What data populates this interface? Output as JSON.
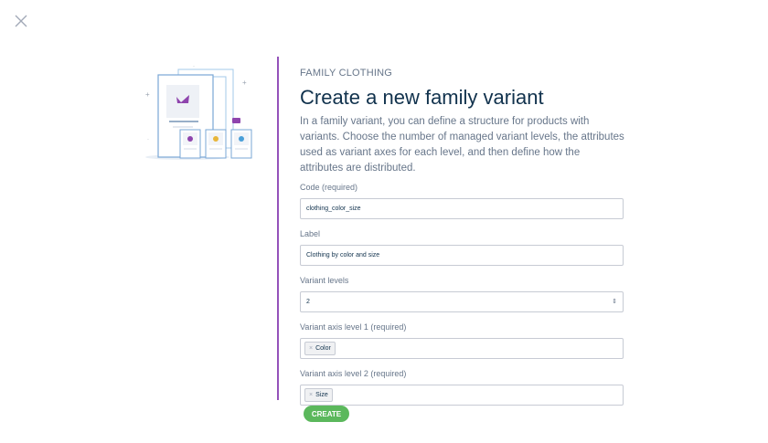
{
  "modal": {
    "close_icon": "close-icon",
    "subtitle": "FAMILY CLOTHING",
    "title": "Create a new family variant",
    "description": "In a family variant, you can define a structure for products with variants. Choose the number of managed variant levels, the attributes used as variant axes for each level, and then define how the attributes are distributed."
  },
  "form": {
    "code": {
      "label": "Code (required)",
      "value": "clothing_color_size"
    },
    "label": {
      "label": "Label",
      "value": "Clothing by color and size"
    },
    "variant_levels": {
      "label": "Variant levels",
      "value": "2"
    },
    "axis_level_1": {
      "label": "Variant axis level 1 (required)",
      "tags": [
        "Color"
      ]
    },
    "axis_level_2": {
      "label": "Variant axis level 2 (required)",
      "tags": [
        "Size"
      ]
    }
  },
  "actions": {
    "create_label": "CREATE"
  },
  "colors": {
    "accent": "#9452ba",
    "create_button": "#5bb85c",
    "title": "#11324d",
    "text": "#67768a"
  }
}
